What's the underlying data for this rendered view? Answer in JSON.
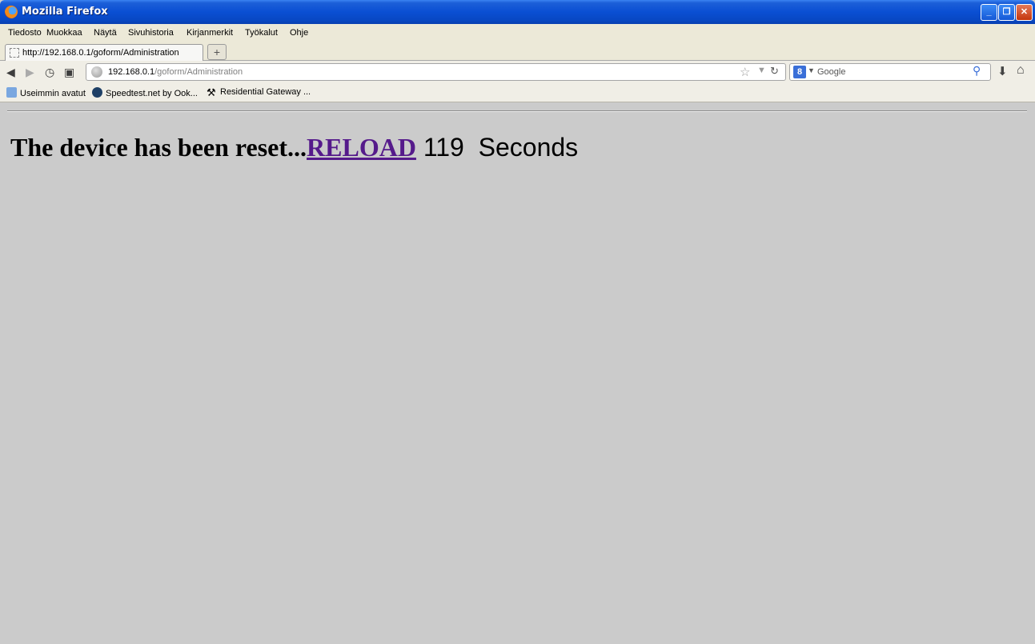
{
  "window": {
    "title": "Mozilla Firefox"
  },
  "menu": {
    "items": [
      "Tiedosto",
      "Muokkaa",
      "Näytä",
      "Sivuhistoria",
      "Kirjanmerkit",
      "Työkalut",
      "Ohje"
    ]
  },
  "tab": {
    "label": "http://192.168.0.1/goform/Administration",
    "new_tab": "+"
  },
  "urlbar": {
    "host": "192.168.0.1",
    "path": "/goform/Administration"
  },
  "search": {
    "placeholder": "Google",
    "engine_letter": "8"
  },
  "bookmarks": [
    "Useimmin avatut",
    "Speedtest.net by Ook...",
    "Residential Gateway ..."
  ],
  "page": {
    "message": "The device has been reset...",
    "reload_link": "RELOAD",
    "countdown": "119",
    "unit": "Seconds"
  },
  "colors": {
    "titlebar": "#0a4fd3",
    "content_bg": "#cbcbcb",
    "visited_link": "#551a8b"
  }
}
